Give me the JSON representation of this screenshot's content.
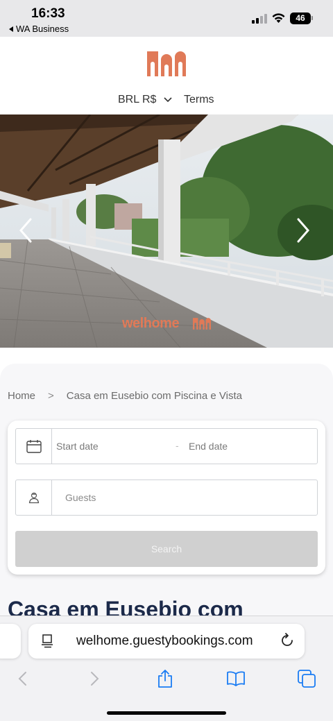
{
  "status_bar": {
    "time": "16:33",
    "back_app": "WA Business",
    "battery": "46"
  },
  "header": {
    "logo_icon": "welhome-arches-logo",
    "currency": "BRL R$",
    "terms": "Terms"
  },
  "hero": {
    "watermark": "welhome",
    "prev_icon": "chevron-left-icon",
    "next_icon": "chevron-right-icon"
  },
  "breadcrumb": {
    "home": "Home",
    "current": "Casa em Eusebio com Piscina e Vista"
  },
  "booking": {
    "start_date_placeholder": "Start date",
    "separator": "-",
    "end_date_placeholder": "End date",
    "guests_placeholder": "Guests",
    "search_label": "Search"
  },
  "property": {
    "title": "Casa em Eusebio com"
  },
  "browser": {
    "url": "welhome.guestybookings.com"
  },
  "colors": {
    "brand": "#e07a58",
    "title": "#1c2a4a",
    "ios_blue": "#1a7cf3",
    "disabled_button": "#d0d0d0"
  }
}
